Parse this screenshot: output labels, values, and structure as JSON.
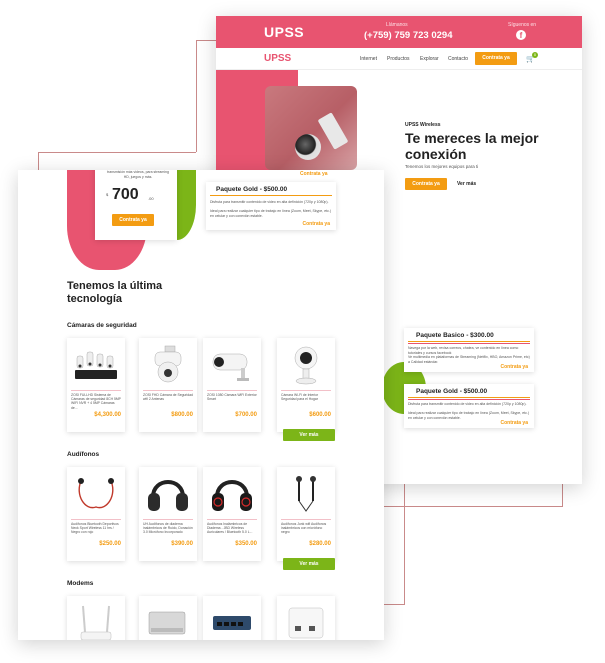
{
  "brand": {
    "name": "UPSS",
    "accent": "#e85470",
    "orange": "#f39c12",
    "green": "#7cb518"
  },
  "topbar": {
    "call_label": "Llámanos",
    "phone": "(+759) 759 723 0294",
    "follow_label": "Síguenos en",
    "social_icon": "facebook-icon"
  },
  "nav": {
    "items": [
      "Internet",
      "Productos",
      "Explorar",
      "Contacto"
    ],
    "cta": "Contrata ya",
    "cart_icon": "cart-icon",
    "cart_count": "0"
  },
  "hero": {
    "kicker": "UPSS Wireless",
    "title": "Te mereces la mejor conexión",
    "subtitle": "Tenemos los mejores equipos para ti",
    "primary_cta": "Contrata ya",
    "secondary_cta": "Ver más"
  },
  "plans": [
    {
      "title": "Paquete Basico - $300.00",
      "lines": [
        "Navega por la web, revisa correos, chatea, ve contenido en línea como tutoriales y cursos facebook",
        "Ve multimedia en plataformas de Streaming (Netflix, HBO, Amazon Prime, etc) a Calidad estándar."
      ],
      "cta": "Contrata ya"
    },
    {
      "title": "Paquete Gold - $500.00",
      "lines": [
        "Disfruta para transmitir contenido de video en alta definición (720p y 1080p).",
        "Ideal para realizar cualquier tipo de trabajo en línea (Zoom, Meet, Skype, etc.) en celular y con conexión estable."
      ],
      "cta": "Contrata ya"
    }
  ],
  "front": {
    "price_desc": "transmisión más videos, para streaming HD, juegos y más.",
    "currency": "$",
    "price": "700",
    "cents": ".00",
    "price_cta": "Contrata ya",
    "gold_plan_top_cta": "Contrata ya",
    "gold_plan": {
      "title": "Paquete Gold - $500.00",
      "lines": [
        "Disfruta para transmitir contenido de video en alta definición (720p y 1080p).",
        "Ideal para realizar cualquier tipo de trabajo en línea (Zoom, Meet, Skype, etc.) en celular y con conexión estable."
      ],
      "cta": "Contrata ya"
    },
    "section_title": "Tenemos la última tecnología",
    "categories": [
      {
        "name": "Cámaras de seguridad",
        "products": [
          {
            "name": "ZOSI FULLHD Sistema de Cámaras de seguridad 8CH 5MP WIFI NVR + 4 5MP Cámaras de...",
            "price": "$4,300.00",
            "icon": "camera-kit-icon"
          },
          {
            "name": "ZOSI FHD Cámara de Seguridad wifi 2 Antenas",
            "price": "$800.00",
            "icon": "ptz-camera-icon"
          },
          {
            "name": "ZOSI 1080 Cámara WiFi Exterior Smart",
            "price": "$700.00",
            "icon": "bullet-camera-icon"
          },
          {
            "name": "Cámara Wi-Fi de Interior Seguridad para el Hogar",
            "price": "$600.00",
            "icon": "indoor-camera-icon"
          }
        ],
        "more": "Ver más"
      },
      {
        "name": "Audífonos",
        "products": [
          {
            "name": "Audífonos Bluetooth Deportivos Neck Sport Wireless 11 hrs / Negro con rojo",
            "price": "$250.00",
            "icon": "neckband-earphones-icon"
          },
          {
            "name": "UH Audífonos de diadema inalámbricos de Ruido, Donación 3.0 Micrófono Incorporado",
            "price": "$390.00",
            "icon": "headphones-black-icon"
          },
          {
            "name": "Audífonos Inalámbricos de Diadema - JBD Wireless Auriculares / Bluetooth 5.0 L...",
            "price": "$350.00",
            "icon": "headphones-red-icon"
          },
          {
            "name": "Audífonos Junk wifi Audífonos inalámbricos con micrófono negro",
            "price": "$280.00",
            "icon": "sport-earphones-icon"
          }
        ],
        "more": "Ver más"
      },
      {
        "name": "Modems",
        "products": [
          {
            "name": "",
            "price": "",
            "icon": "router-icon"
          },
          {
            "name": "",
            "price": "",
            "icon": "switch-silver-icon"
          },
          {
            "name": "",
            "price": "",
            "icon": "switch-blue-icon"
          },
          {
            "name": "",
            "price": "",
            "icon": "access-point-icon"
          }
        ]
      }
    ]
  }
}
